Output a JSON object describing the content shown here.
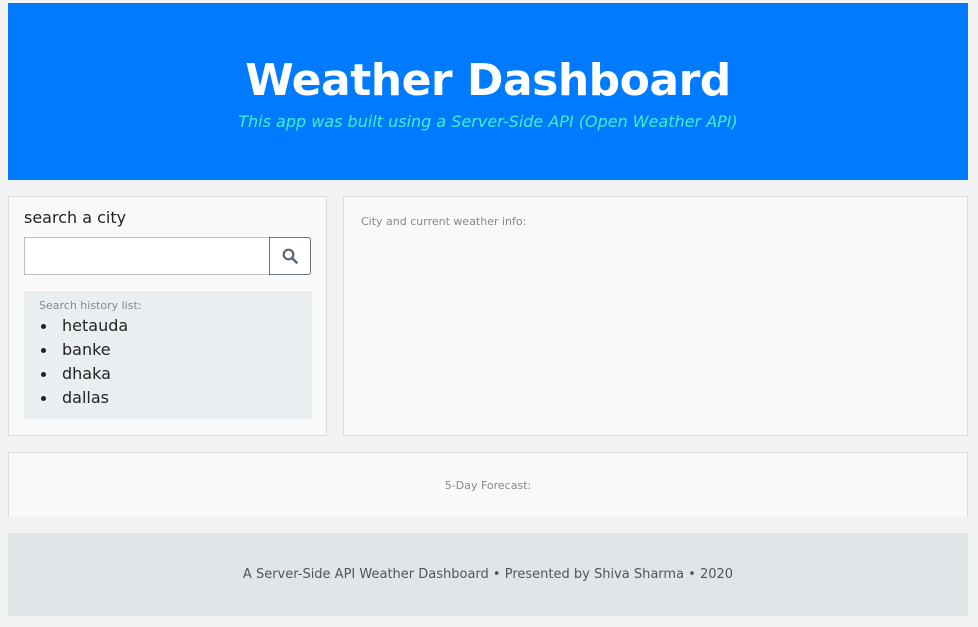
{
  "header": {
    "title": "Weather Dashboard",
    "subtitle": "This app was built using a Server-Side API (Open Weather API)",
    "background_color": "#007bff",
    "subtitle_color": "#3ff0c8"
  },
  "search": {
    "label": "search a city",
    "input_value": "",
    "button_icon": "search-icon"
  },
  "history": {
    "title": "Search history list:",
    "items": [
      {
        "label": "hetauda"
      },
      {
        "label": "banke"
      },
      {
        "label": "dhaka"
      },
      {
        "label": "dallas"
      }
    ]
  },
  "weather": {
    "title": "City and current weather info:"
  },
  "forecast": {
    "title": "5-Day Forecast:"
  },
  "footer": {
    "text": "A Server-Side API Weather Dashboard • Presented by Shiva Sharma • 2020"
  }
}
